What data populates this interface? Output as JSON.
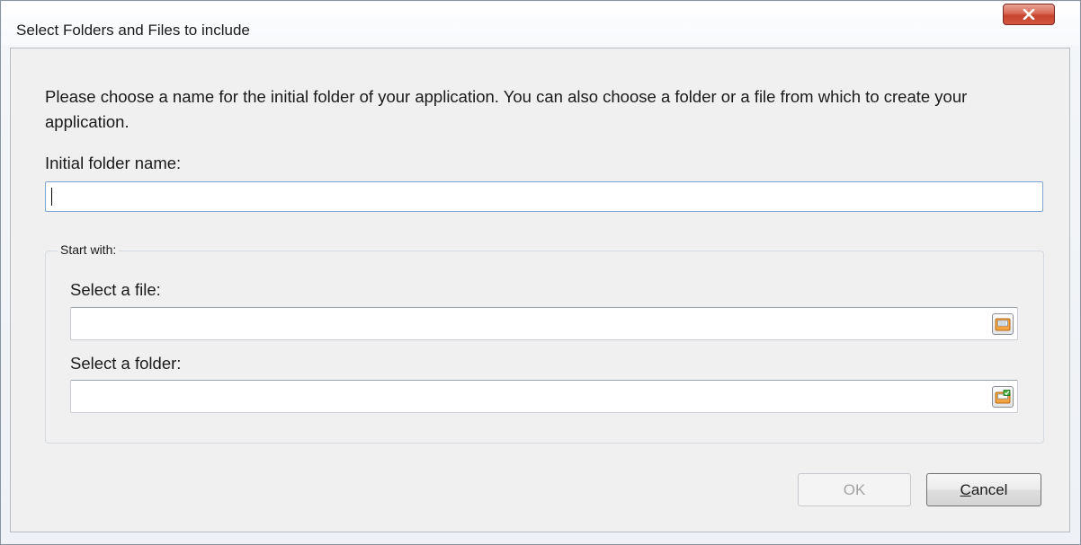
{
  "window": {
    "title": "Select Folders and Files to include",
    "close_icon": "close-x-icon"
  },
  "intro": {
    "text": "Please choose a name for the initial folder of your application. You can also choose a folder or a file from which to create your application."
  },
  "initial_folder": {
    "label": "Initial folder name:",
    "value": ""
  },
  "start_with": {
    "group_label": "Start with:",
    "file": {
      "label": "Select a file:",
      "value": "",
      "browse_icon": "browse-file-icon"
    },
    "folder": {
      "label": "Select a folder:",
      "value": "",
      "browse_icon": "browse-folder-icon"
    }
  },
  "buttons": {
    "ok_label": "OK",
    "ok_enabled": false,
    "cancel_mnemonic": "C",
    "cancel_rest": "ancel"
  },
  "colors": {
    "close_button": "#d05a45",
    "input_focus_border": "#7ea6d2",
    "disabled_text": "#a3a3a3"
  }
}
